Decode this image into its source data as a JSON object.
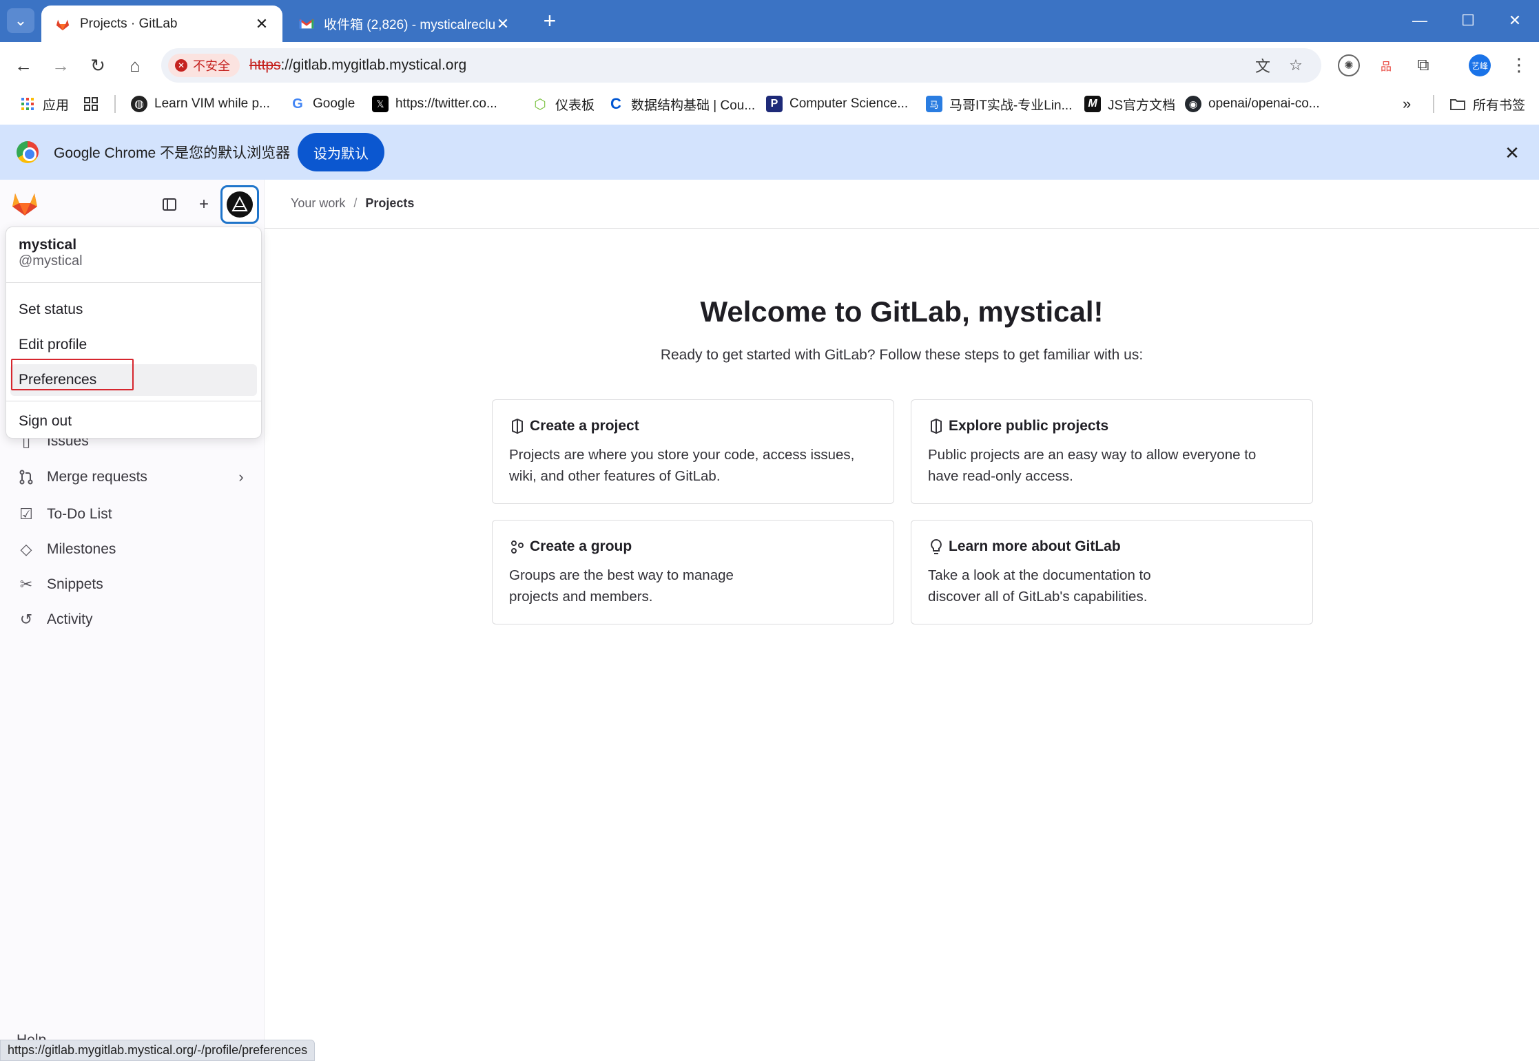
{
  "browser": {
    "tabs": [
      {
        "title": "Projects · GitLab",
        "active": true,
        "icon": "gitlab-fox-icon"
      },
      {
        "title": "收件箱 (2,826) - mysticalreclu",
        "active": false,
        "icon": "gmail-icon"
      }
    ],
    "security_label": "不安全",
    "url_scheme": "https",
    "url_rest": "://gitlab.mygitlab.mystical.org",
    "profile_initials": "艺峰",
    "bookmarks": [
      {
        "label": "应用",
        "icon": "apps-grid-icon"
      },
      {
        "label": "",
        "icon": "tab-groups-icon"
      },
      {
        "label": "Learn VIM while p...",
        "icon": "globe-icon"
      },
      {
        "label": "Google",
        "icon": "google-icon"
      },
      {
        "label": "https://twitter.co...",
        "icon": "x-icon"
      },
      {
        "label": "仪表板",
        "icon": "cube-icon"
      },
      {
        "label": "数据结构基础 | Cou...",
        "icon": "coursera-icon"
      },
      {
        "label": "Computer Science...",
        "icon": "p-icon"
      },
      {
        "label": "马哥IT实战-专业Lin...",
        "icon": "magedu-icon"
      },
      {
        "label": "JS官方文档",
        "icon": "m-icon"
      },
      {
        "label": "openai/openai-co...",
        "icon": "github-icon"
      }
    ],
    "more_bookmarks": "»",
    "all_bookmarks": "所有书签",
    "infobar_text": "Google Chrome 不是您的默认浏览器",
    "infobar_button": "设为默认",
    "status_url": "https://gitlab.mygitlab.mystical.org/-/profile/preferences"
  },
  "user_menu": {
    "name": "mystical",
    "handle": "@mystical",
    "items": [
      "Set status",
      "Edit profile",
      "Preferences",
      "Sign out"
    ]
  },
  "sidebar": {
    "items": [
      {
        "label": "Issues",
        "icon": "issues-icon"
      },
      {
        "label": "Merge requests",
        "icon": "merge-request-icon"
      },
      {
        "label": "To-Do List",
        "icon": "todo-checkbox-icon"
      },
      {
        "label": "Milestones",
        "icon": "milestone-diamond-icon"
      },
      {
        "label": "Snippets",
        "icon": "scissors-icon"
      },
      {
        "label": "Activity",
        "icon": "history-icon"
      }
    ],
    "help_peek": "Help"
  },
  "main": {
    "breadcrumb": [
      "Your work",
      "Projects"
    ],
    "welcome": "Welcome to GitLab, mystical!",
    "subtitle": "Ready to get started with GitLab? Follow these steps to get familiar with us:",
    "cards": [
      {
        "title": "Create a project",
        "desc": "Projects are where you store your code, access issues, wiki, and other features of GitLab.",
        "icon": "project-icon"
      },
      {
        "title": "Explore public projects",
        "desc": "Public projects are an easy way to allow everyone to have read-only access.",
        "icon": "project-icon"
      },
      {
        "title": "Create a group",
        "desc": "Groups are the best way to manage projects and members.",
        "icon": "group-icon"
      },
      {
        "title": "Learn more about GitLab",
        "desc": "Take a look at the documentation to discover all of GitLab's capabilities.",
        "icon": "lightbulb-icon"
      }
    ]
  },
  "colors": {
    "tabstrip": "#3b73c4",
    "infobar": "#d3e3fd",
    "highlight": "#d6262e",
    "gitlab_orange": "#fc6d26"
  }
}
